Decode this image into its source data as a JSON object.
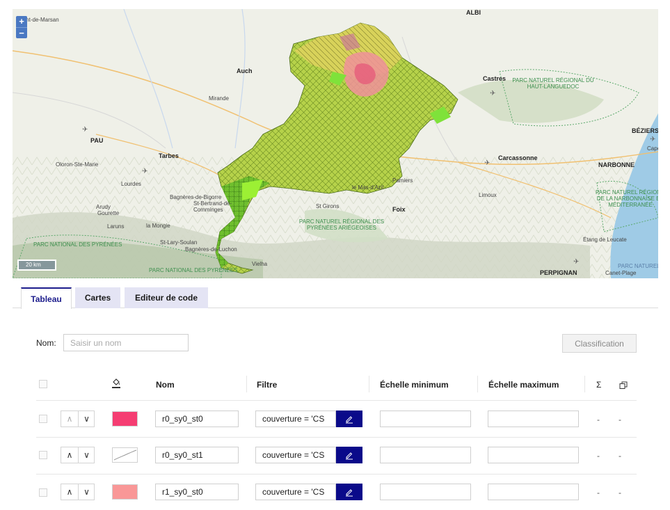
{
  "map": {
    "zoom_in": "+",
    "zoom_out": "−",
    "scale": "20 km",
    "places": {
      "mont_de_marsan": "Mont-de-Marsan",
      "auch": "Auch",
      "mirande": "Mirande",
      "pau": "PAU",
      "tarbes": "Tarbes",
      "oloron": "Oloron-Ste-Marie",
      "lourdes": "Lourdes",
      "bagneres": "Bagnères-de-Bigorre",
      "st_bertrand": "St-Bertrand-de-Comminges",
      "arudy": "Arudy",
      "castres": "Castres",
      "carcassonne": "Carcassonne",
      "beziers": "BÉZIERS",
      "narbonne": "NARBONNE",
      "pamiers": "Pamiers",
      "limoux": "Limoux",
      "foix": "Foix",
      "st_girons": "St Girons",
      "le_mas": "le Mas-d'Azil",
      "perpignan": "PERPIGNAN",
      "canet": "Canet-Plage",
      "albi": "ALBI",
      "capestang": "Capestang",
      "vielha": "Vielha",
      "bagneres_luchon": "Bagnères-de-Luchon",
      "le_mongie": "la Mongie",
      "saint_lary": "St-Lary-Soulan",
      "laruns": "Laruns",
      "gourette": "Gourette",
      "etang": "Étang de Leucate"
    },
    "parks": {
      "haut_languedoc": "PARC NATUREL RÉGIONAL DU\nHAUT-LANGUEDOC",
      "pyrenees_ariegeoises": "PARC NATUREL RÉGIONAL DES\nPYRÉNÉES ARIÉGEOISES",
      "narbonnaise": "PARC NATUREL RÉGIONAL\nDE LA NARBONNAISE EN\nMÉDITERRANÉE",
      "pyrenees_national": "PARC NATIONAL DES PYRÉNÉES",
      "parc_national_bottom": "PARC NATIONAL DES PYRÉNÉES",
      "parc_marin": "PARC NATUREL"
    }
  },
  "tabs": [
    {
      "label": "Tableau"
    },
    {
      "label": "Cartes"
    },
    {
      "label": "Editeur de code"
    }
  ],
  "filter": {
    "nom_label": "Nom:",
    "nom_placeholder": "Saisir un nom",
    "classification_label": "Classification"
  },
  "table": {
    "headers": {
      "nom": "Nom",
      "filtre": "Filtre",
      "echelle_min": "Échelle minimum",
      "echelle_max": "Échelle maximum",
      "sigma": "Σ"
    },
    "rows": [
      {
        "nom": "r0_sy0_st0",
        "filtre": "couverture = 'CS",
        "echelle_min": "",
        "echelle_max": "",
        "sum": "-",
        "copy": "-",
        "color": "#f53d72"
      },
      {
        "nom": "r0_sy0_st1",
        "filtre": "couverture = 'CS",
        "echelle_min": "",
        "echelle_max": "",
        "sum": "-",
        "copy": "-",
        "color": "#ffffff"
      },
      {
        "nom": "r1_sy0_st0",
        "filtre": "couverture = 'CS",
        "echelle_min": "",
        "echelle_max": "",
        "sum": "-",
        "copy": "-",
        "color": "#f99797"
      }
    ]
  }
}
